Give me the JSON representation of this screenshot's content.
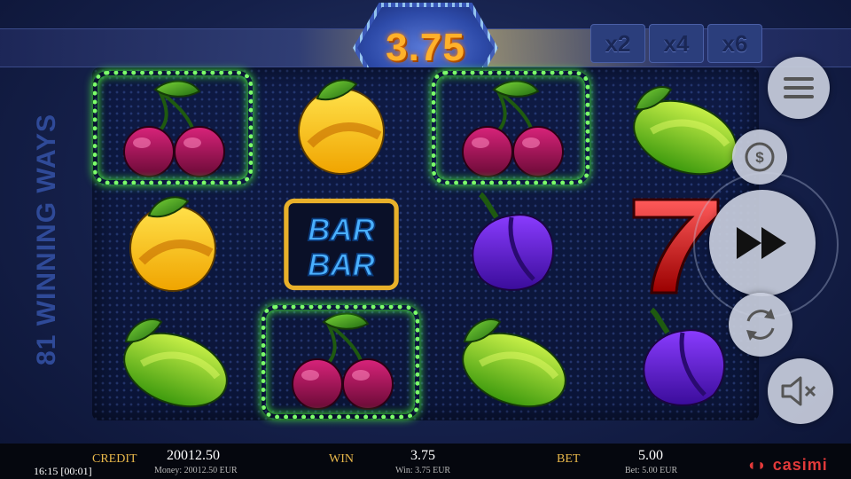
{
  "header": {
    "win_display": "3.75",
    "multipliers": [
      "x2",
      "x4",
      "x6"
    ]
  },
  "side_label": "81 WINNING WAYS",
  "reels": {
    "columns": [
      [
        "cherries-icon",
        "orange-icon",
        "lime-icon"
      ],
      [
        "orange-icon",
        "bar-bar-icon",
        "cherries-icon"
      ],
      [
        "cherries-icon",
        "plum-icon",
        "lime-icon"
      ],
      [
        "lime-icon",
        "seven-icon",
        "plum-icon"
      ]
    ],
    "winning_symbol": "cherries-icon"
  },
  "controls": {
    "menu_icon": "menu-icon",
    "coin_icon": "coin-dollar-icon",
    "spin_icon": "fast-forward-icon",
    "autoplay_icon": "refresh-icon",
    "sound_icon": "speaker-muted-icon"
  },
  "footer": {
    "clock": "16:15 [00:01]",
    "credit_label": "CREDIT",
    "credit_value": "20012.50",
    "credit_sub": "Money: 20012.50 EUR",
    "win_label": "WIN",
    "win_value": "3.75",
    "win_sub": "Win: 3.75 EUR",
    "bet_label": "BET",
    "bet_value": "5.00",
    "bet_sub": "Bet: 5.00 EUR",
    "brand": "casimi"
  },
  "colors": {
    "win_frame": "#7cff6a",
    "win_text": "#ffb12a",
    "label_gold": "#e8b74a",
    "brand_red": "#e23a3a"
  }
}
